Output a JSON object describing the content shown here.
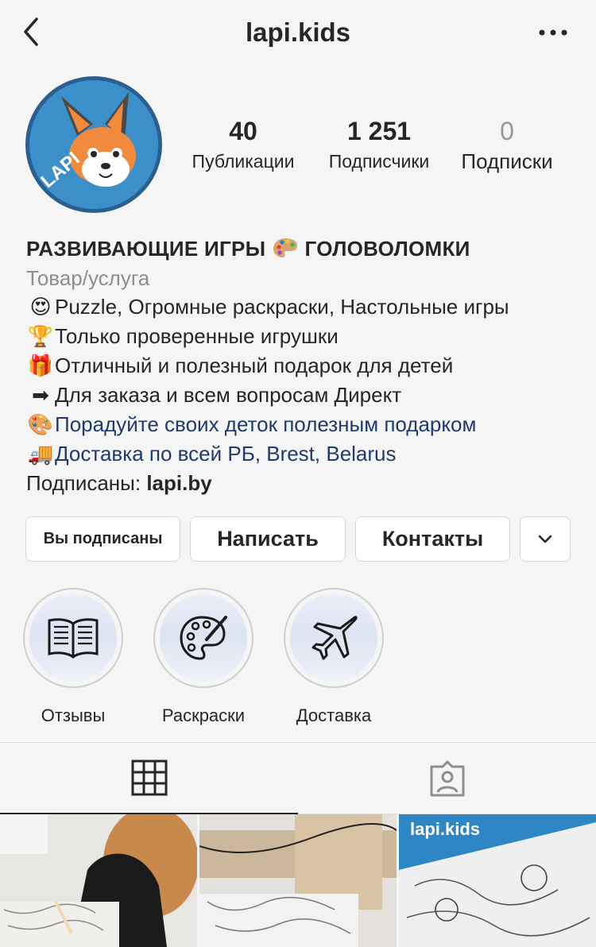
{
  "header": {
    "username": "lapi.kids",
    "back_icon": "chevron-left-icon",
    "more_icon": "more-horizontal-icon"
  },
  "avatar": {
    "logo_text": "LAPI"
  },
  "stats": {
    "posts": {
      "value": "40",
      "label": "Публикации"
    },
    "followers": {
      "value": "1 251",
      "label": "Подписчики"
    },
    "following": {
      "value": "0",
      "label": "Подписки"
    }
  },
  "bio": {
    "name_part1": "РАЗВИВАЮЩИЕ ИГРЫ",
    "name_part2": "ГОЛОВОЛОМКИ",
    "category": "Товар/услуга",
    "lines": [
      {
        "emoji": "😍",
        "text": "Puzzle, Огромные раскраски, Настольные игры"
      },
      {
        "emoji": "🏆",
        "text": "Только проверенные игрушки"
      },
      {
        "emoji": "🎁",
        "text": "Отличный и полезный подарок для детей"
      },
      {
        "emoji": "➡",
        "text": "Для заказа и всем вопросам Директ"
      },
      {
        "emoji": "🎨",
        "text": "Порадуйте своих деток полезным подарком"
      },
      {
        "emoji": "🚚",
        "text": "Доставка по всей РБ, Brest, Belarus"
      }
    ],
    "followed_by_label": "Подписаны:",
    "followed_by_user": "lapi.by"
  },
  "buttons": {
    "following": "Вы подписаны",
    "message": "Написать",
    "contacts": "Контакты",
    "more_icon": "chevron-down-icon"
  },
  "highlights": [
    {
      "label": "Отзывы",
      "icon": "book-icon"
    },
    {
      "label": "Раскраски",
      "icon": "palette-icon"
    },
    {
      "label": "Доставка",
      "icon": "airplane-icon"
    }
  ],
  "tabs": [
    {
      "icon": "grid-icon",
      "active": true
    },
    {
      "icon": "tagged-person-icon",
      "active": false
    }
  ],
  "posts_preview": {
    "third_label": "lapi.kids"
  },
  "colors": {
    "background": "#f5f5f5",
    "text": "#262626",
    "muted": "#8e8e8e",
    "link": "#1f3a6e",
    "avatar_blue": "#3d8fc9"
  }
}
